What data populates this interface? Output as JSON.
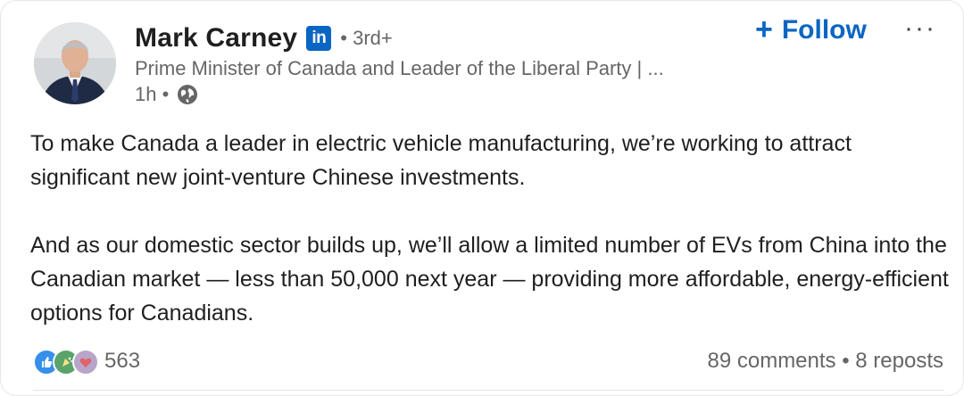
{
  "author": {
    "name": "Mark Carney",
    "linkedin_badge": "in",
    "degree": "• 3rd+",
    "headline": "Prime Minister of Canada and Leader of the Liberal Party | ...",
    "time": "1h •",
    "visibility_icon": "globe-icon"
  },
  "actions": {
    "follow_icon": "+",
    "follow_label": "Follow",
    "more_label": "···"
  },
  "post": {
    "paragraphs": [
      "To make Canada a leader in electric vehicle manufacturing, we’re working to attract significant new joint-venture Chinese investments.",
      "And as our domestic sector builds up, we’ll allow a limited number of EVs from China into the Canadian market — less than 50,000 next year — providing more affordable, energy-efficient options for Canadians."
    ]
  },
  "social": {
    "reaction_icons": [
      "like-icon",
      "celebrate-icon",
      "love-icon"
    ],
    "reaction_count": "563",
    "stats": "89 comments • 8 reposts"
  },
  "colors": {
    "accent": "#0a66c2",
    "secondary_text": "#666666"
  }
}
